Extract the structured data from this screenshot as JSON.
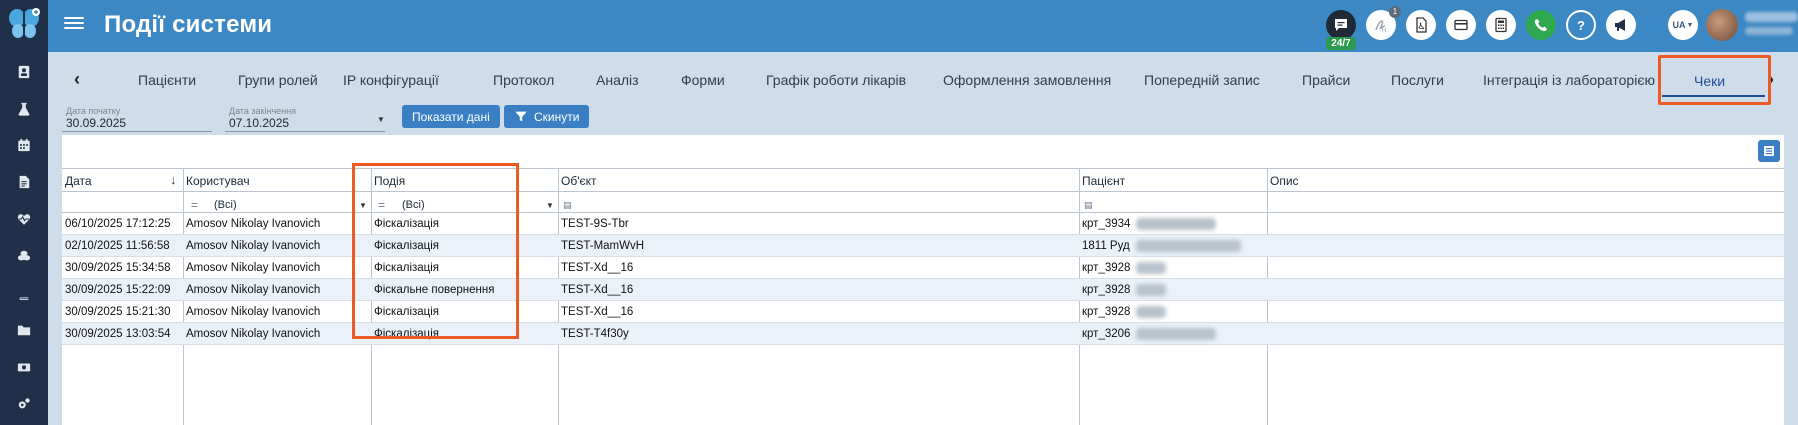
{
  "app": {
    "page_title": "Події системи",
    "chat_badge": "24/7",
    "notification_count": "1",
    "language": "UA",
    "accent_color": "#3b88c4",
    "sidebar_color": "#1f3048",
    "highlight_color": "#ee5a24"
  },
  "header_icons": [
    "chat-icon",
    "handwriting-icon",
    "pdf-icon",
    "card-icon",
    "calculator-icon",
    "phone-icon",
    "help-icon",
    "megaphone-icon"
  ],
  "sidebar_icons": [
    "user-card-icon",
    "flask-icon",
    "calendar-icon",
    "document-icon",
    "heartbeat-icon",
    "coins-icon",
    "book-icon",
    "folder-icon",
    "money-icon",
    "gears-icon"
  ],
  "tabs": [
    {
      "label": "Пацієнти"
    },
    {
      "label": "Групи ролей"
    },
    {
      "label": "IP конфігурації"
    },
    {
      "label": "Протокол"
    },
    {
      "label": "Аналіз"
    },
    {
      "label": "Форми"
    },
    {
      "label": "Графік роботи лікарів"
    },
    {
      "label": "Оформлення замовлення"
    },
    {
      "label": "Попередній запис"
    },
    {
      "label": "Прайси"
    },
    {
      "label": "Послуги"
    },
    {
      "label": "Інтеграція із лабораторією"
    },
    {
      "label": "Чеки",
      "active": true
    }
  ],
  "filters": {
    "start_label": "Дата початку",
    "start_value": "30.09.2025",
    "end_label": "Дата закінчення",
    "end_value": "07.10.2025",
    "show_button": "Показати дані",
    "reset_button": "Скинути"
  },
  "table": {
    "columns": [
      "Дата",
      "Користувач",
      "Подія",
      "Об'єкт",
      "Пацієнт",
      "Опис"
    ],
    "filter_all": "(Всі)",
    "filter_eq": "=",
    "rows": [
      {
        "date": "06/10/2025 17:12:25",
        "user": "Amosov Nikolay Ivanovich",
        "event": "Фіскалізація",
        "object": "TEST-9S-Tbr",
        "patient": "крт_3934"
      },
      {
        "date": "02/10/2025 11:56:58",
        "user": "Amosov Nikolay Ivanovich",
        "event": "Фіскалізація",
        "object": "TEST-MamWvH",
        "patient": "1811 Руд"
      },
      {
        "date": "30/09/2025 15:34:58",
        "user": "Amosov Nikolay Ivanovich",
        "event": "Фіскалізація",
        "object": "TEST-Xd__16",
        "patient": "крт_3928"
      },
      {
        "date": "30/09/2025 15:22:09",
        "user": "Amosov Nikolay Ivanovich",
        "event": "Фіскальне повернення",
        "object": "TEST-Xd__16",
        "patient": "крт_3928"
      },
      {
        "date": "30/09/2025 15:21:30",
        "user": "Amosov Nikolay Ivanovich",
        "event": "Фіскалізація",
        "object": "TEST-Xd__16",
        "patient": "крт_3928"
      },
      {
        "date": "30/09/2025 13:03:54",
        "user": "Amosov Nikolay Ivanovich",
        "event": "Фіскалізація",
        "object": "TEST-T4f30y",
        "patient": "крт_3206"
      }
    ]
  }
}
